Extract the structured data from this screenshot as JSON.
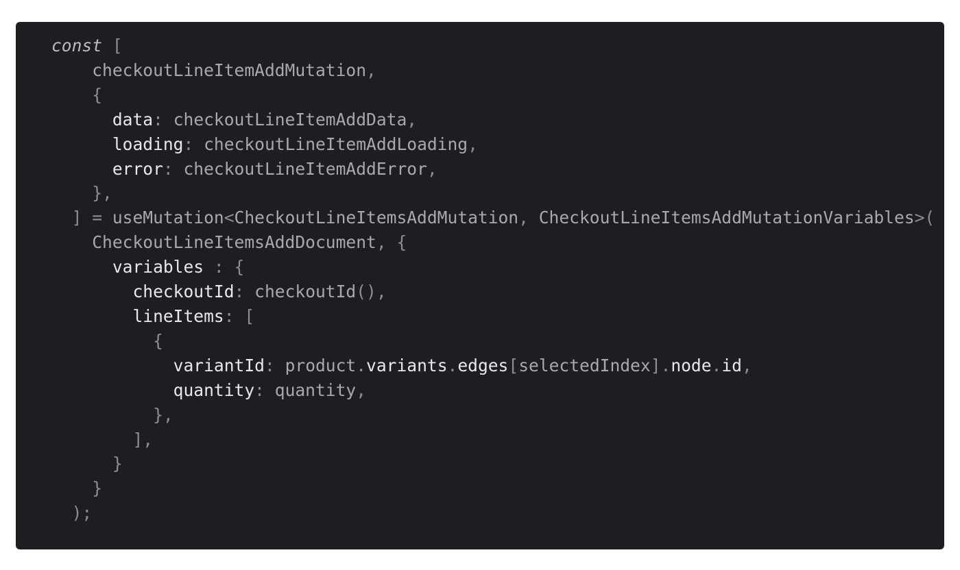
{
  "code": {
    "language": "typescript",
    "lines": [
      [
        {
          "t": "const",
          "c": "kw"
        },
        {
          "t": " [",
          "c": "punct"
        }
      ],
      [
        {
          "t": "    checkoutLineItemAddMutation",
          "c": "dim"
        },
        {
          "t": ",",
          "c": "punct"
        }
      ],
      [
        {
          "t": "    {",
          "c": "punct"
        }
      ],
      [
        {
          "t": "      data",
          "c": "bright"
        },
        {
          "t": ": ",
          "c": "punct"
        },
        {
          "t": "checkoutLineItemAddData",
          "c": "dim"
        },
        {
          "t": ",",
          "c": "punct"
        }
      ],
      [
        {
          "t": "      loading",
          "c": "bright"
        },
        {
          "t": ": ",
          "c": "punct"
        },
        {
          "t": "checkoutLineItemAddLoading",
          "c": "dim"
        },
        {
          "t": ",",
          "c": "punct"
        }
      ],
      [
        {
          "t": "      error",
          "c": "bright"
        },
        {
          "t": ": ",
          "c": "punct"
        },
        {
          "t": "checkoutLineItemAddError",
          "c": "dim"
        },
        {
          "t": ",",
          "c": "punct"
        }
      ],
      [
        {
          "t": "    },",
          "c": "punct"
        }
      ],
      [
        {
          "t": "  ] = ",
          "c": "punct"
        },
        {
          "t": "useMutation",
          "c": "dim"
        },
        {
          "t": "<",
          "c": "punct"
        },
        {
          "t": "CheckoutLineItemsAddMutation",
          "c": "dim"
        },
        {
          "t": ", ",
          "c": "punct"
        },
        {
          "t": "CheckoutLineItemsAddMutationVariables",
          "c": "dim"
        },
        {
          "t": ">(",
          "c": "punct"
        }
      ],
      [
        {
          "t": "    CheckoutLineItemsAddDocument",
          "c": "dim"
        },
        {
          "t": ", {",
          "c": "punct"
        }
      ],
      [
        {
          "t": "      variables",
          "c": "bright"
        },
        {
          "t": " : {",
          "c": "punct"
        }
      ],
      [
        {
          "t": "        checkoutId",
          "c": "bright"
        },
        {
          "t": ": ",
          "c": "punct"
        },
        {
          "t": "checkoutId",
          "c": "dim"
        },
        {
          "t": "(),",
          "c": "punct"
        }
      ],
      [
        {
          "t": "        lineItems",
          "c": "bright"
        },
        {
          "t": ": [",
          "c": "punct"
        }
      ],
      [
        {
          "t": "          {",
          "c": "punct"
        }
      ],
      [
        {
          "t": "            variantId",
          "c": "bright"
        },
        {
          "t": ": ",
          "c": "punct"
        },
        {
          "t": "product",
          "c": "dim"
        },
        {
          "t": ".",
          "c": "punct"
        },
        {
          "t": "variants",
          "c": "bright"
        },
        {
          "t": ".",
          "c": "punct"
        },
        {
          "t": "edges",
          "c": "bright"
        },
        {
          "t": "[",
          "c": "punct"
        },
        {
          "t": "selectedIndex",
          "c": "dim"
        },
        {
          "t": "].",
          "c": "punct"
        },
        {
          "t": "node",
          "c": "bright"
        },
        {
          "t": ".",
          "c": "punct"
        },
        {
          "t": "id",
          "c": "bright"
        },
        {
          "t": ",",
          "c": "punct"
        }
      ],
      [
        {
          "t": "            quantity",
          "c": "bright"
        },
        {
          "t": ": ",
          "c": "punct"
        },
        {
          "t": "quantity",
          "c": "dim"
        },
        {
          "t": ",",
          "c": "punct"
        }
      ],
      [
        {
          "t": "          },",
          "c": "punct"
        }
      ],
      [
        {
          "t": "        ],",
          "c": "punct"
        }
      ],
      [
        {
          "t": "      }",
          "c": "punct"
        }
      ],
      [
        {
          "t": "    }",
          "c": "punct"
        }
      ],
      [
        {
          "t": "  );",
          "c": "punct"
        }
      ]
    ]
  },
  "colors": {
    "background": "#1d1d22",
    "page": "#ffffff",
    "keyword": "#b9bcc4",
    "property": "#e8e8ec",
    "identifier": "#a7a9b0",
    "punctuation": "#8c8e96"
  }
}
